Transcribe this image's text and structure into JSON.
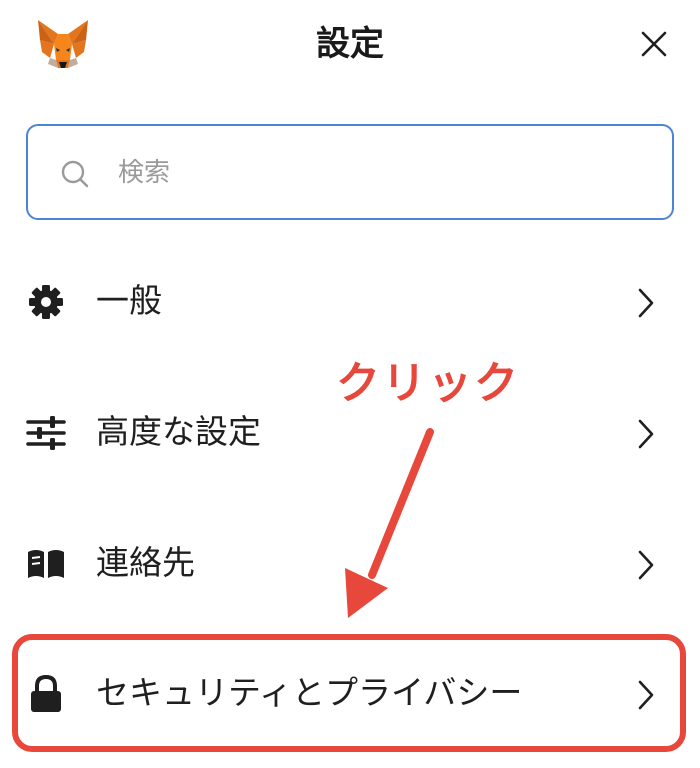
{
  "header": {
    "title": "設定",
    "logo_icon": "metamask-fox-icon",
    "close_icon": "close-icon"
  },
  "search": {
    "placeholder": "検索",
    "value": "",
    "icon": "search-icon"
  },
  "menu": {
    "items": [
      {
        "label": "一般",
        "icon": "gear-icon"
      },
      {
        "label": "高度な設定",
        "icon": "sliders-icon"
      },
      {
        "label": "連絡先",
        "icon": "book-icon"
      },
      {
        "label": "セキュリティとプライバシー",
        "icon": "lock-icon"
      }
    ]
  },
  "annotation": {
    "text": "クリック",
    "color": "#e8473c"
  },
  "colors": {
    "search_border": "#4c84d6",
    "text": "#1f1f1f",
    "placeholder": "#9a9a9a",
    "annotation": "#e8473c"
  }
}
